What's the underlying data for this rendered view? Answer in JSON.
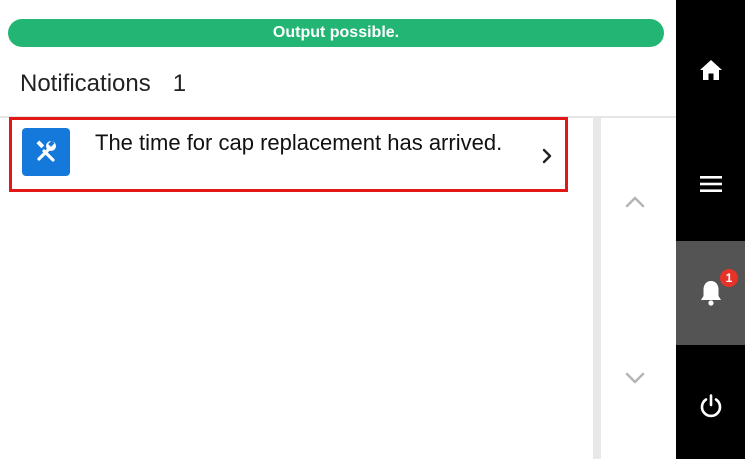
{
  "status": {
    "message": "Output possible.",
    "color": "#23b574"
  },
  "header": {
    "title": "Notifications",
    "count": "1"
  },
  "notifications": [
    {
      "icon": "wrench-screwdriver-icon",
      "text": "The time for cap replacement has arrived.",
      "selected": true
    }
  ],
  "scroll": {
    "up_icon": "chevron-up-icon",
    "down_icon": "chevron-down-icon"
  },
  "sidebar": {
    "items": [
      {
        "icon": "home-icon"
      },
      {
        "icon": "menu-icon"
      },
      {
        "icon": "bell-icon",
        "badge": "1",
        "active": true
      },
      {
        "icon": "power-icon"
      }
    ]
  },
  "colors": {
    "accent_blue": "#1579dc",
    "selection_red": "#e31717",
    "badge_red": "#e6332a",
    "sidebar_bg": "#000000",
    "sidebar_active": "#545454"
  }
}
